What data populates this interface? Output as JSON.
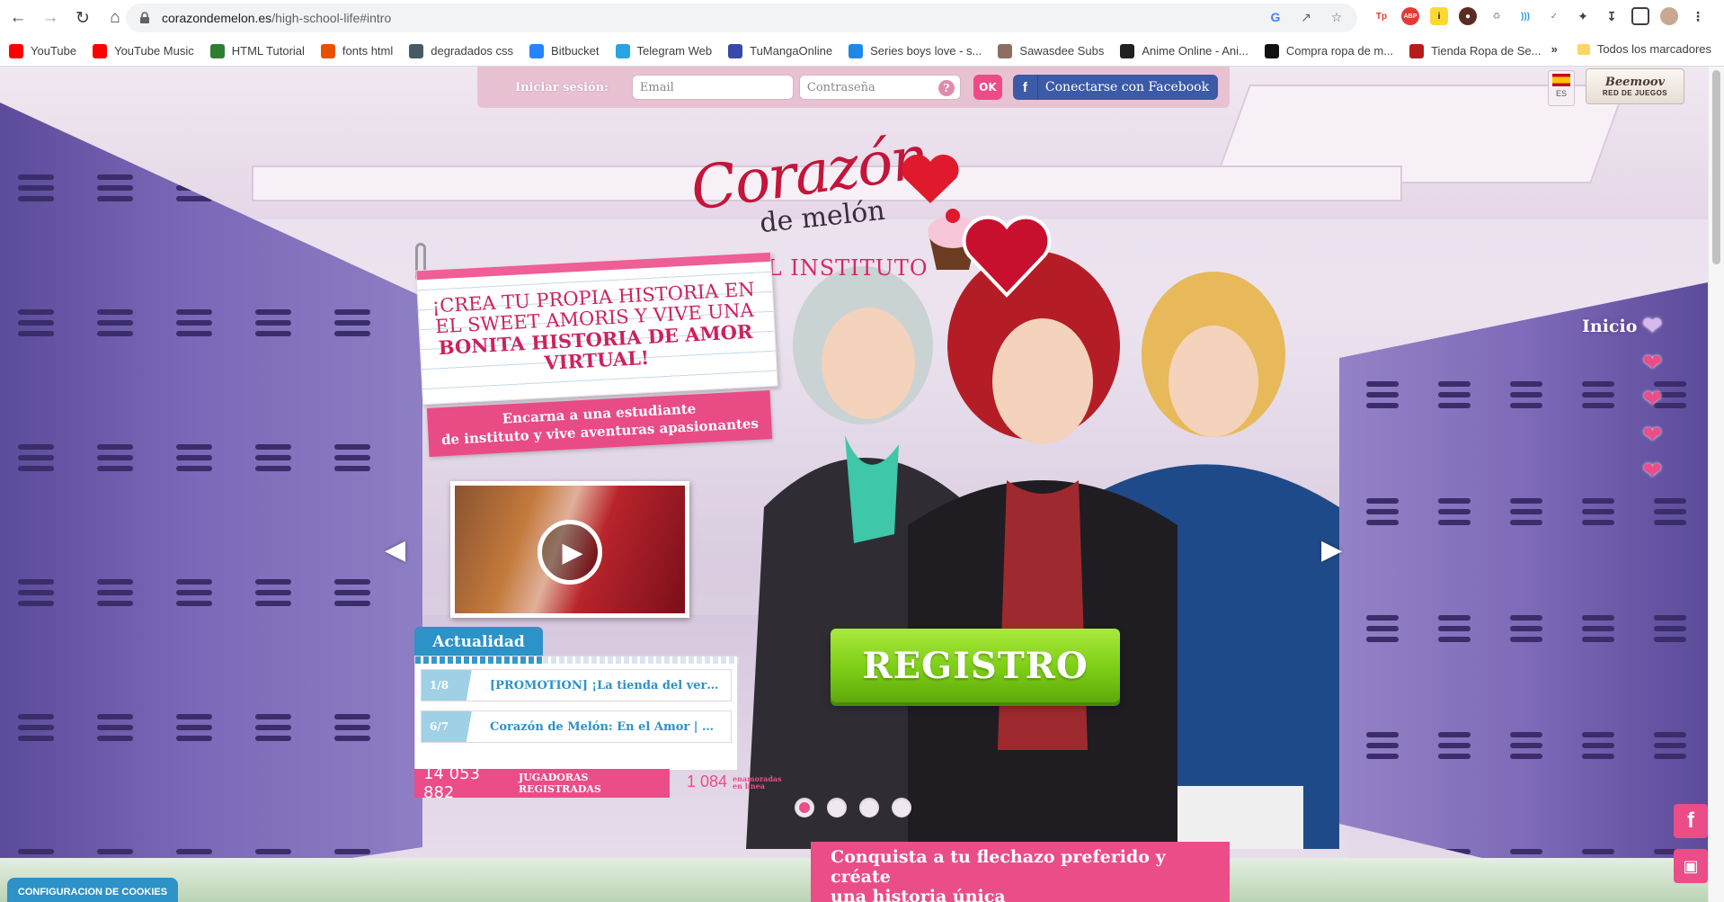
{
  "browser": {
    "url_domain": "corazondemelon.es",
    "url_path": "/high-school-life#intro",
    "bookmarks": [
      {
        "label": "YouTube",
        "color": "#ff0000",
        "icon": "youtube-icon"
      },
      {
        "label": "YouTube Music",
        "color": "#ff0000",
        "icon": "youtube-music-icon"
      },
      {
        "label": "HTML Tutorial",
        "color": "#2e7d32",
        "icon": "w3-icon"
      },
      {
        "label": "fonts html",
        "color": "#e65100",
        "icon": "fonts-icon"
      },
      {
        "label": "degradados css",
        "color": "#455a64",
        "icon": "folder-icon"
      },
      {
        "label": "Bitbucket",
        "color": "#2684ff",
        "icon": "bitbucket-icon"
      },
      {
        "label": "Telegram Web",
        "color": "#2aa3e0",
        "icon": "telegram-icon"
      },
      {
        "label": "TuMangaOnline",
        "color": "#3949ab",
        "icon": "tmo-icon"
      },
      {
        "label": "Series boys love - s...",
        "color": "#1e88e5",
        "icon": "heart-icon"
      },
      {
        "label": "Sawasdee Subs",
        "color": "#8d6e63",
        "icon": "sawasdee-icon"
      },
      {
        "label": "Anime Online - Ani...",
        "color": "#212121",
        "icon": "anime-icon"
      },
      {
        "label": "Compra ropa de m...",
        "color": "#111111",
        "icon": "m-icon"
      },
      {
        "label": "Tienda Ropa de Se...",
        "color": "#b71c1c",
        "icon": "rp-icon"
      }
    ],
    "all_bookmarks_label": "Todos los marcadores"
  },
  "login": {
    "label": "Iniciar sesión:",
    "email_placeholder": "Email",
    "password_placeholder": "Contraseña",
    "help": "?",
    "ok": "OK",
    "facebook_icon_letter": "f",
    "facebook": "Conectarse con Facebook"
  },
  "lang": {
    "code": "ES"
  },
  "network": {
    "brand": "Beemoov",
    "subtitle": "RED DE JUEGOS"
  },
  "logo": {
    "title": "Corazón",
    "subtitle": "de melón",
    "tagline": "EN EL INSTITUTO"
  },
  "intro": {
    "line1": "¡CREA TU PROPIA HISTORIA EN EL SWEET AMORIS Y VIVE UNA",
    "line2": "BONITA HISTORIA DE AMOR VIRTUAL!",
    "ribbon_line1": "Encarna a una estudiante",
    "ribbon_line2": "de instituto y vive aventuras apasionantes"
  },
  "news": {
    "tab": "Actualidad",
    "items": [
      {
        "date": "1/8",
        "title": "[PROMOTION] ¡La tienda del vera..."
      },
      {
        "date": "6/7",
        "title": "Corazón de Melón: En el Amor | L..."
      }
    ]
  },
  "stats": {
    "registered_count": "14 053 882",
    "registered_label": "JUGADORAS REGISTRADAS",
    "online_count": "1 084",
    "online_label_1": "enamoradas",
    "online_label_2": "en línea"
  },
  "register": {
    "label": "REGISTRO"
  },
  "carousel": {
    "total": 4,
    "active": 0
  },
  "side_nav": {
    "label": "Inicio"
  },
  "bottom": {
    "banner_line1": "Conquista a tu flechazo preferido y créate",
    "banner_line2": "una historia única",
    "cookies": "CONFIGURACION DE COOKIES"
  },
  "colors": {
    "accent_pink": "#ea4d87",
    "news_blue": "#2c92c8",
    "register_green": "#7ccd15"
  }
}
